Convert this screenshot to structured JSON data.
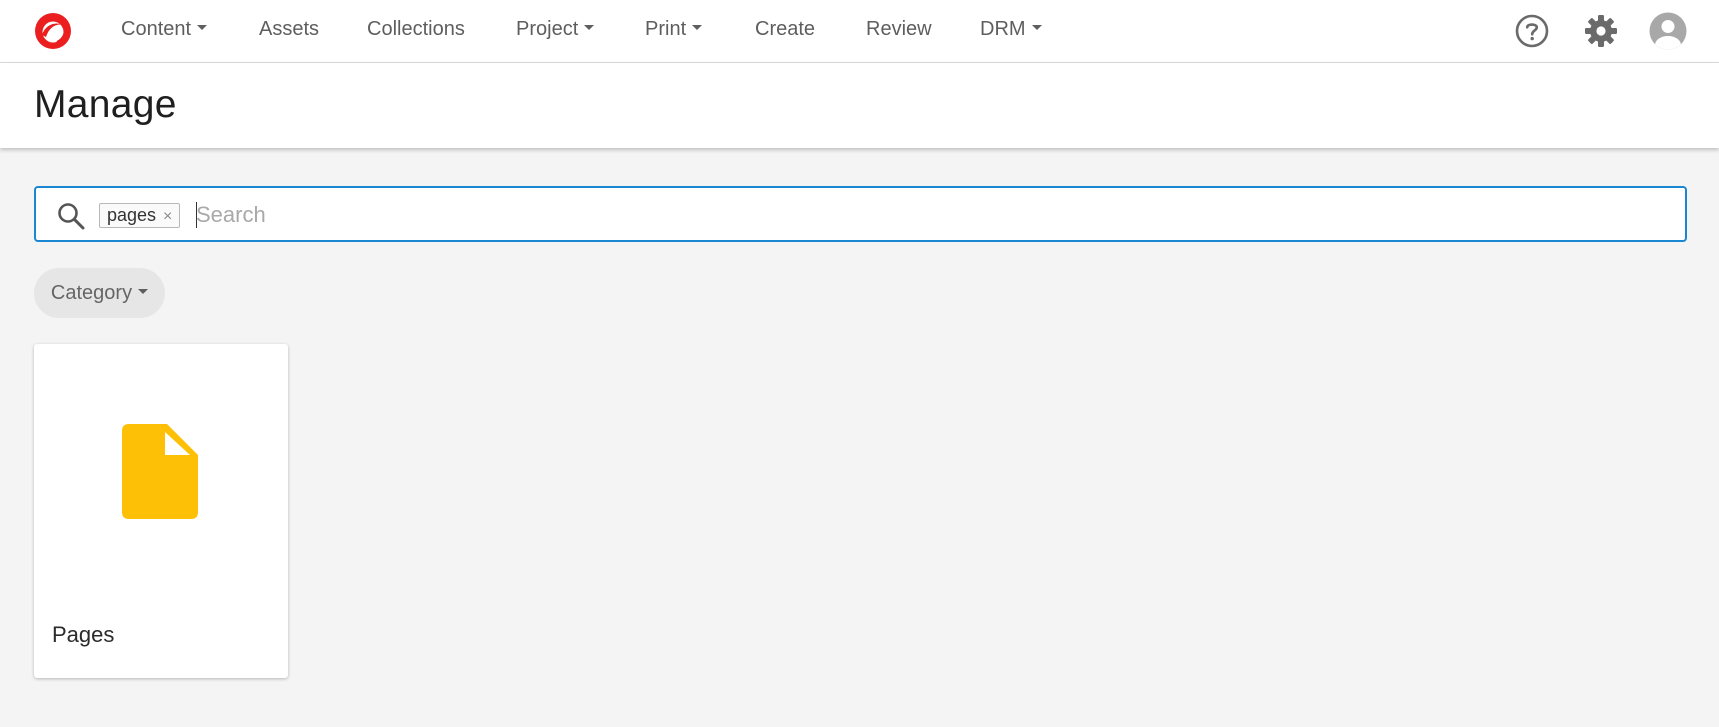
{
  "nav": {
    "items": [
      {
        "label": "Content",
        "dropdown": true
      },
      {
        "label": "Assets",
        "dropdown": false
      },
      {
        "label": "Collections",
        "dropdown": false
      },
      {
        "label": "Project",
        "dropdown": true
      },
      {
        "label": "Print",
        "dropdown": true
      },
      {
        "label": "Create",
        "dropdown": false
      },
      {
        "label": "Review",
        "dropdown": false
      },
      {
        "label": "DRM",
        "dropdown": true
      }
    ],
    "icons": [
      "help-icon",
      "gear-icon",
      "user-avatar-icon"
    ]
  },
  "header": {
    "title": "Manage"
  },
  "search": {
    "chip": "pages",
    "chip_remove": "×",
    "placeholder": "Search",
    "value": ""
  },
  "filters": {
    "category_label": "Category"
  },
  "cards": [
    {
      "label": "Pages",
      "icon": "document-icon"
    }
  ],
  "colors": {
    "brand": "#eb1f1f",
    "accent": "#1b86d1",
    "document_icon": "#fec006"
  }
}
